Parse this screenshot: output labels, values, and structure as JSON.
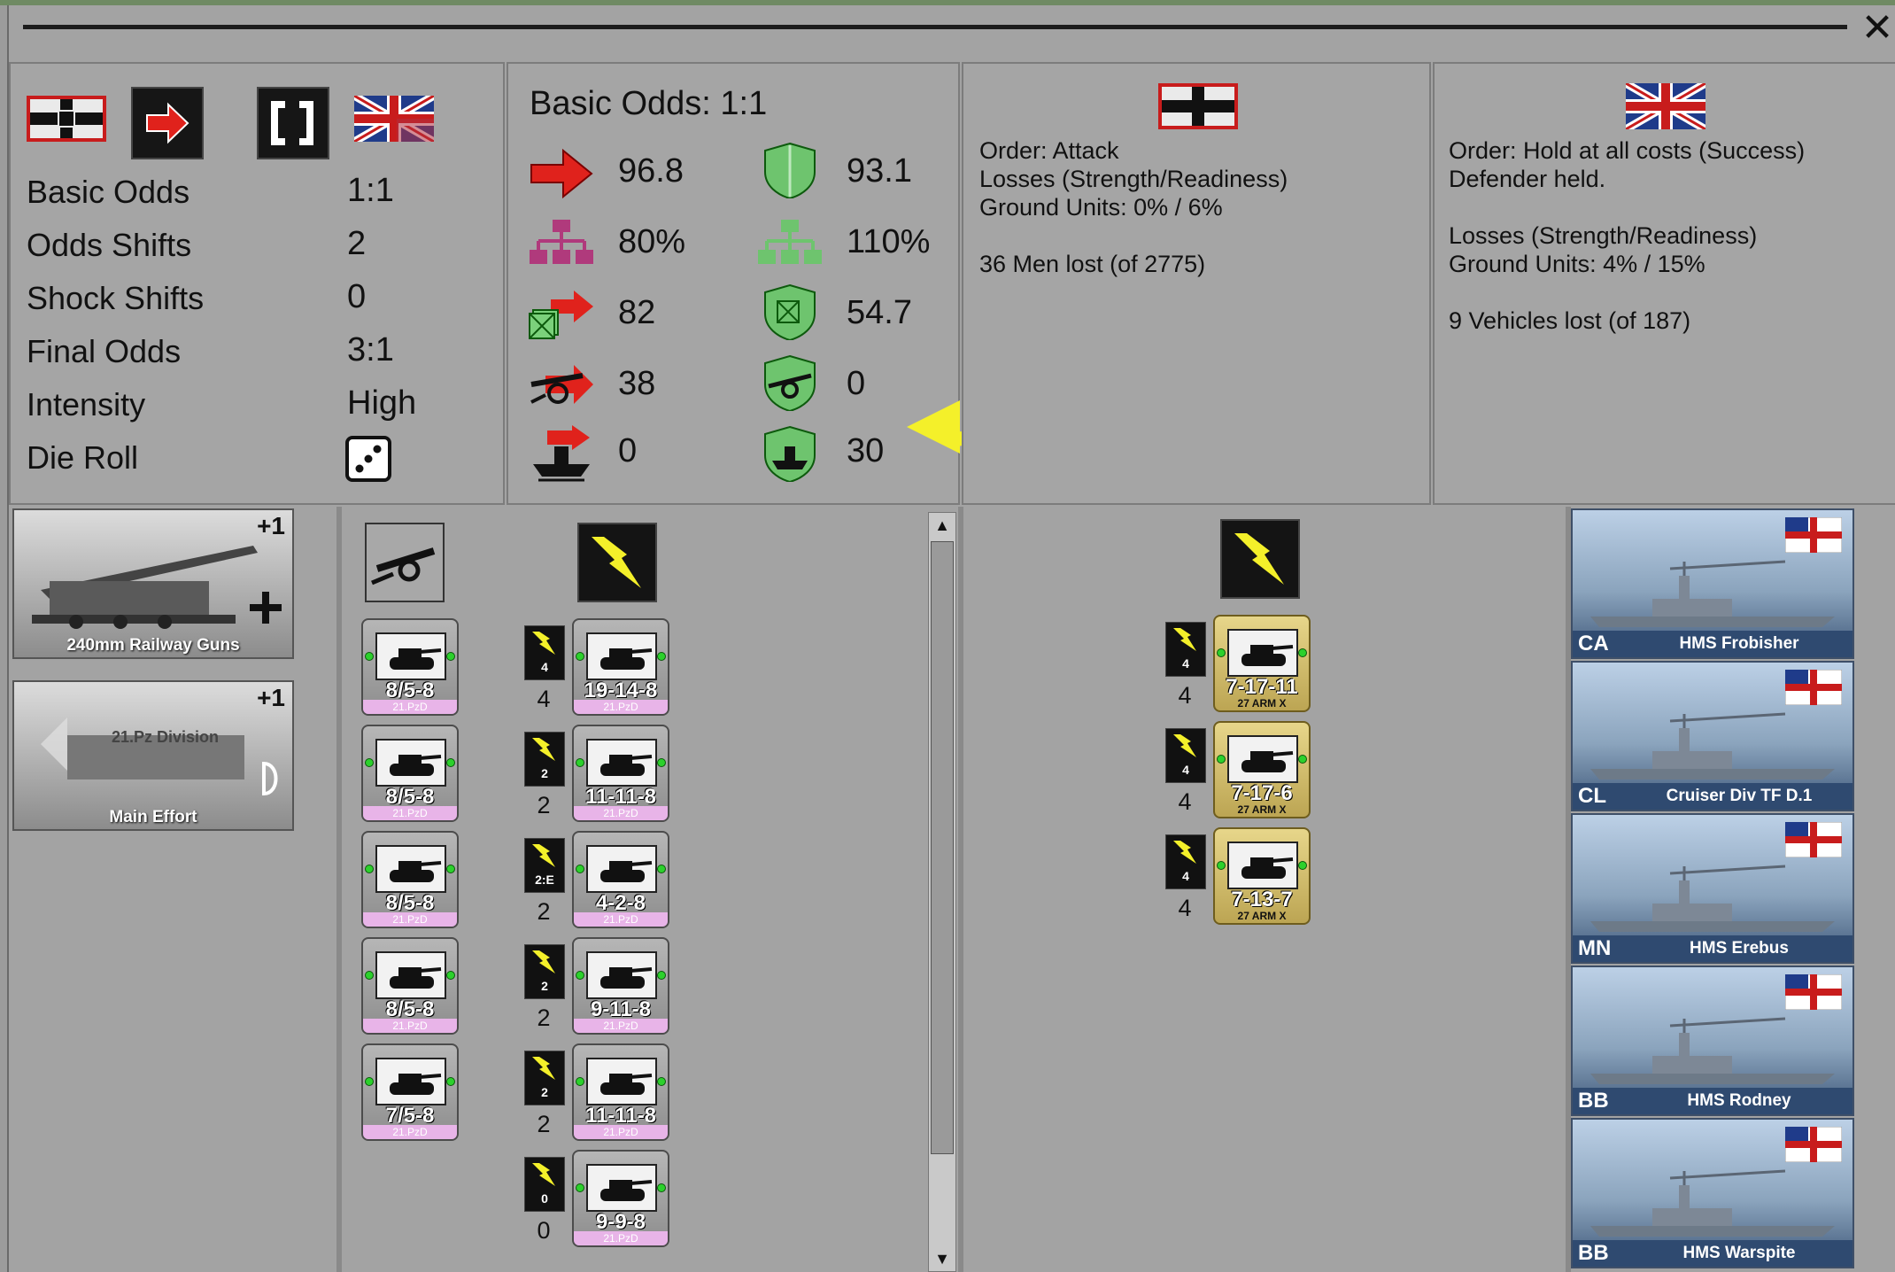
{
  "combat": {
    "basic_odds_label": "Basic Odds",
    "basic_odds_value": "1:1",
    "odds_shifts_label": "Odds Shifts",
    "odds_shifts_value": "2",
    "shock_shifts_label": "Shock Shifts",
    "shock_shifts_value": "0",
    "final_odds_label": "Final Odds",
    "final_odds_value": "3:1",
    "intensity_label": "Intensity",
    "intensity_value": "High",
    "die_roll_label": "Die Roll"
  },
  "strength": {
    "header": "Basic Odds: 1:1",
    "attacker": [
      "96.8",
      "80%",
      "82",
      "38",
      "0"
    ],
    "defender": [
      "93.1",
      "110%",
      "54.7",
      "0",
      "30"
    ]
  },
  "attacker_result": {
    "lines": [
      "Order: Attack",
      "Losses (Strength/Readiness)",
      "Ground Units: 0% / 6%",
      "",
      "36 Men lost (of 2775)"
    ]
  },
  "defender_result": {
    "lines": [
      "Order: Hold at all costs (Success)",
      "Defender held.",
      "",
      "Losses (Strength/Readiness)",
      "Ground Units: 4% / 15%",
      "",
      "9 Vehicles lost (of 187)"
    ]
  },
  "support_cards": [
    {
      "caption": "240mm Railway Guns",
      "bonus": "+1"
    },
    {
      "caption": "Main Effort",
      "subtitle": "21.Pz Division",
      "bonus": "+1"
    }
  ],
  "artillery_units": [
    {
      "stats": "8/5-8",
      "org": "21.PzD"
    },
    {
      "stats": "8/5-8",
      "org": "21.PzD"
    },
    {
      "stats": "8/5-8",
      "org": "21.PzD"
    },
    {
      "stats": "8/5-8",
      "org": "21.PzD"
    },
    {
      "stats": "7/5-8",
      "org": "21.PzD"
    }
  ],
  "german_units": [
    {
      "shock": "4",
      "count": "4",
      "stats": "19-14-8",
      "org": "21.PzD"
    },
    {
      "shock": "2",
      "count": "2",
      "stats": "11-11-8",
      "org": "21.PzD"
    },
    {
      "shock": "2:E",
      "count": "2",
      "stats": "4-2-8",
      "org": "21.PzD"
    },
    {
      "shock": "2",
      "count": "2",
      "stats": "9-11-8",
      "org": "21.PzD"
    },
    {
      "shock": "2",
      "count": "2",
      "stats": "11-11-8",
      "org": "21.PzD"
    },
    {
      "shock": "0",
      "count": "0",
      "stats": "9-9-8",
      "org": "21.PzD"
    }
  ],
  "allied_units": [
    {
      "shock": "4",
      "count": "4",
      "stats": "7-17-11",
      "org": "27 ARM X"
    },
    {
      "shock": "4",
      "count": "4",
      "stats": "7-17-6",
      "org": "27 ARM X"
    },
    {
      "shock": "4",
      "count": "4",
      "stats": "7-13-7",
      "org": "27 ARM X"
    }
  ],
  "ships": [
    {
      "type": "CA",
      "name": "HMS Frobisher"
    },
    {
      "type": "CL",
      "name": "Cruiser Div TF D.1"
    },
    {
      "type": "MN",
      "name": "HMS Erebus"
    },
    {
      "type": "BB",
      "name": "HMS Rodney"
    },
    {
      "type": "BB",
      "name": "HMS Warspite"
    }
  ],
  "colors": {
    "attack_red": "#e0221c",
    "defense_green": "#6ec46e",
    "org_magenta": "#b03a7c",
    "arrow_yellow": "#f4f02a"
  },
  "icons": {
    "close": "✕",
    "scroll_up": "▲",
    "scroll_down": "▼"
  }
}
